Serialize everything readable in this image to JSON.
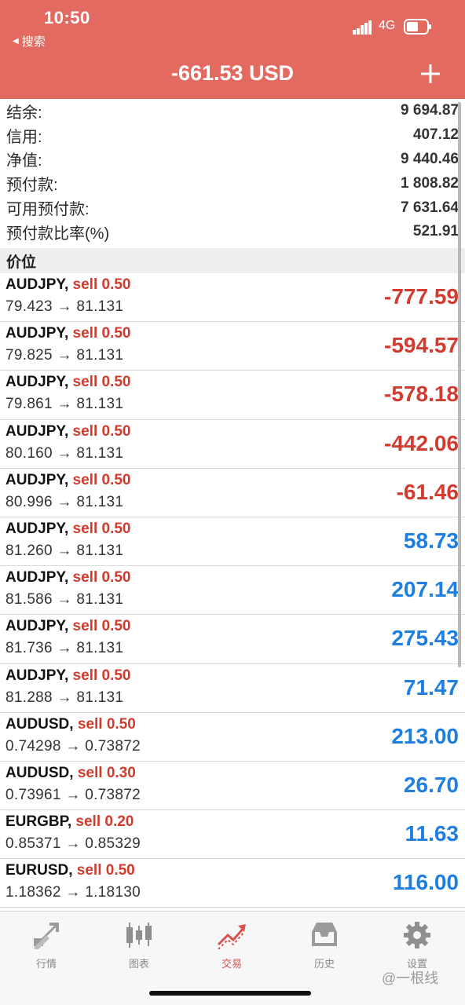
{
  "status_bar": {
    "time": "10:50",
    "back_label": "搜索",
    "network": "4G"
  },
  "nav": {
    "title": "-661.53 USD"
  },
  "summary": [
    {
      "label": "结余:",
      "value": "9 694.87"
    },
    {
      "label": "信用:",
      "value": "407.12"
    },
    {
      "label": "净值:",
      "value": "9 440.46"
    },
    {
      "label": "预付款:",
      "value": "1 808.82"
    },
    {
      "label": "可用预付款:",
      "value": "7 631.64"
    },
    {
      "label": "预付款比率(%)",
      "value": "521.91"
    }
  ],
  "section_title": "价位",
  "positions": [
    {
      "symbol": "AUDJPY,",
      "side": "sell 0.50",
      "prices": "79.423 → 81.131",
      "profit": "-777.59",
      "sign": "neg"
    },
    {
      "symbol": "AUDJPY,",
      "side": "sell 0.50",
      "prices": "79.825 → 81.131",
      "profit": "-594.57",
      "sign": "neg"
    },
    {
      "symbol": "AUDJPY,",
      "side": "sell 0.50",
      "prices": "79.861 → 81.131",
      "profit": "-578.18",
      "sign": "neg"
    },
    {
      "symbol": "AUDJPY,",
      "side": "sell 0.50",
      "prices": "80.160 → 81.131",
      "profit": "-442.06",
      "sign": "neg"
    },
    {
      "symbol": "AUDJPY,",
      "side": "sell 0.50",
      "prices": "80.996 → 81.131",
      "profit": "-61.46",
      "sign": "neg"
    },
    {
      "symbol": "AUDJPY,",
      "side": "sell 0.50",
      "prices": "81.260 → 81.131",
      "profit": "58.73",
      "sign": "pos"
    },
    {
      "symbol": "AUDJPY,",
      "side": "sell 0.50",
      "prices": "81.586 → 81.131",
      "profit": "207.14",
      "sign": "pos"
    },
    {
      "symbol": "AUDJPY,",
      "side": "sell 0.50",
      "prices": "81.736 → 81.131",
      "profit": "275.43",
      "sign": "pos"
    },
    {
      "symbol": "AUDJPY,",
      "side": "sell 0.50",
      "prices": "81.288 → 81.131",
      "profit": "71.47",
      "sign": "pos"
    },
    {
      "symbol": "AUDUSD,",
      "side": "sell 0.50",
      "prices": "0.74298 → 0.73872",
      "profit": "213.00",
      "sign": "pos"
    },
    {
      "symbol": "AUDUSD,",
      "side": "sell 0.30",
      "prices": "0.73961 → 0.73872",
      "profit": "26.70",
      "sign": "pos"
    },
    {
      "symbol": "EURGBP,",
      "side": "sell 0.20",
      "prices": "0.85371 → 0.85329",
      "profit": "11.63",
      "sign": "pos"
    },
    {
      "symbol": "EURUSD,",
      "side": "sell 0.50",
      "prices": "1.18362 → 1.18130",
      "profit": "116.00",
      "sign": "pos"
    }
  ],
  "tabs": [
    {
      "label": "行情",
      "icon": "quotes-icon",
      "active": false
    },
    {
      "label": "图表",
      "icon": "chart-icon",
      "active": false
    },
    {
      "label": "交易",
      "icon": "trade-icon",
      "active": true
    },
    {
      "label": "历史",
      "icon": "history-icon",
      "active": false
    },
    {
      "label": "设置",
      "icon": "settings-icon",
      "active": false
    }
  ],
  "watermark": "@一根线",
  "colors": {
    "header_bg": "#e26a61",
    "loss": "#d23b2f",
    "gain": "#1f7fe0",
    "sell": "#d03b2e",
    "active_tab": "#d9534f"
  }
}
